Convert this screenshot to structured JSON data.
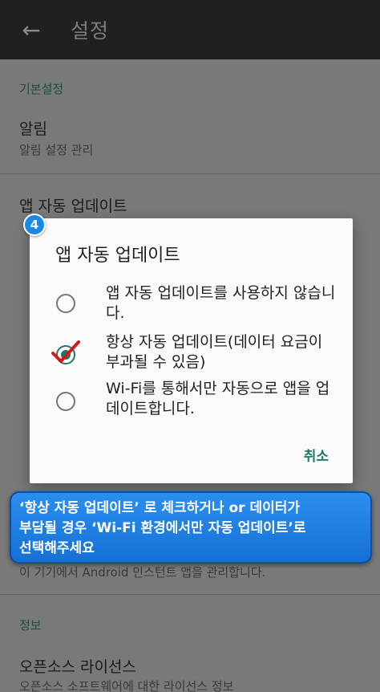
{
  "appbar": {
    "back_icon": "arrow-back-icon",
    "title": "설정"
  },
  "sections": {
    "basic_header": "기본설정",
    "info_header": "정보"
  },
  "prefs": {
    "notifications_title": "알림",
    "notifications_summary": "알림 설정 관리",
    "autoupdate_title": "앱 자동 업데이트",
    "instant_apps_summary": "이 기기에서 Android 인스턴트 앱을 관리합니다.",
    "oss_title": "오픈소스 라이선스",
    "oss_summary": "오픈소스 소프트웨어에 대한 라이선스 정보"
  },
  "dialog": {
    "title": "앱 자동 업데이트",
    "options": [
      {
        "label": "앱 자동 업데이트를 사용하지 않습니다.",
        "checked": false
      },
      {
        "label": "항상 자동 업데이트(데이터 요금이 부과될 수 있음)",
        "checked": true
      },
      {
        "label": "Wi-Fi를 통해서만 자동으로 앱을 업데이트합니다.",
        "checked": false
      }
    ],
    "cancel_label": "취소"
  },
  "step_badge": "4",
  "callout": "‘항상 자동 업데이트’ 로 체크하거나 or 데이터가\n부담될 경우 ‘Wi-Fi 환경에서만 자동 업데이트’로\n선택해주세요",
  "colors": {
    "accent": "#1e7a63",
    "callout": "#1a88e8",
    "annotation_check": "#d11a1a"
  }
}
